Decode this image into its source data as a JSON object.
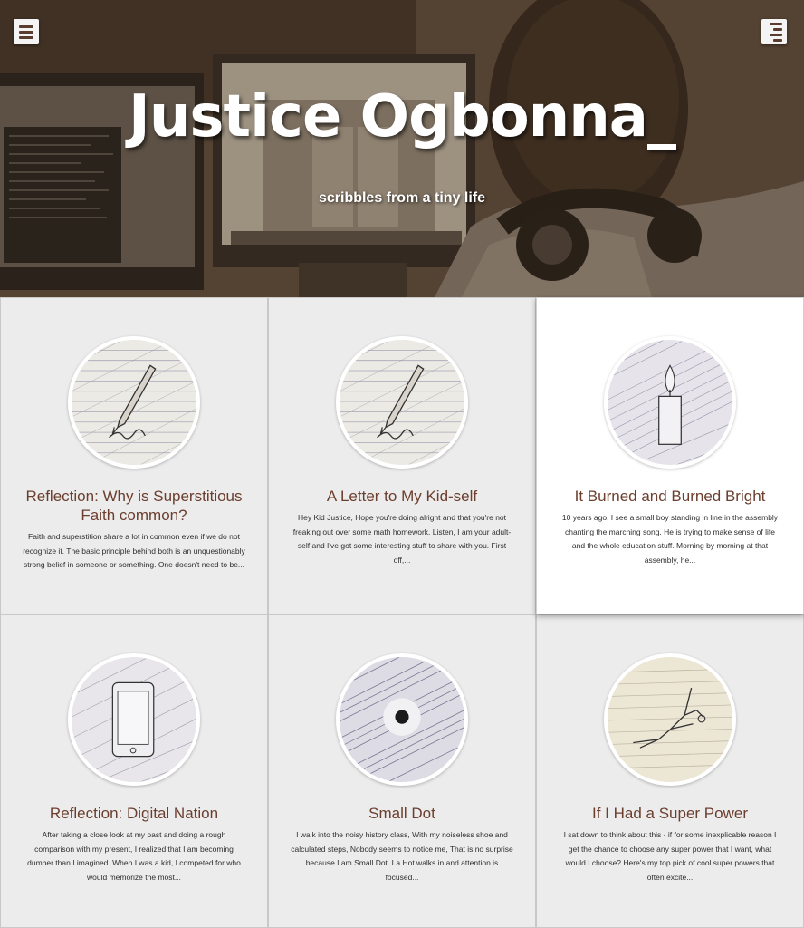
{
  "header": {
    "title": "Justice Ogbonna_",
    "tagline": "scribbles from a tiny life",
    "menu_left_icon": "hamburger-menu-icon",
    "menu_right_icon": "list-menu-icon"
  },
  "colors": {
    "title_text": "#ffffff",
    "card_title": "#6b3e2e",
    "card_bg": "#ececec",
    "card_active_bg": "#ffffff"
  },
  "posts": [
    {
      "title": "Reflection: Why is Superstitious Faith common?",
      "excerpt": "Faith and superstition share a lot in common even if we do not recognize it. The basic principle behind both is an unquestionably strong belief in someone or something. One doesn't need to be...",
      "thumbnail_icon": "fountain-pen-icon"
    },
    {
      "title": "A Letter to My Kid-self",
      "excerpt": "Hey Kid Justice, Hope you're doing alright and that you're not freaking out over some math homework. Listen, I am your adult-self and I've got some interesting stuff to share with you. First off,...",
      "thumbnail_icon": "fountain-pen-icon"
    },
    {
      "title": "It Burned and Burned Bright",
      "excerpt": "10 years ago, I see a small boy standing in line in the assembly chanting the marching song. He is trying to make sense of life and the whole education stuff. Morning by morning at that assembly, he...",
      "thumbnail_icon": "candle-icon"
    },
    {
      "title": "Reflection: Digital Nation",
      "excerpt": "After taking a close look at my past and doing a rough comparison with my present, I realized that I am becoming dumber than I imagined. When I was a kid, I competed for who would memorize the most...",
      "thumbnail_icon": "smartphone-icon"
    },
    {
      "title": "Small Dot",
      "excerpt": "I walk into the noisy history class, With my noiseless shoe and calculated steps, Nobody seems to notice me, That is no surprise because I am Small Dot. La Hot walks in and attention is focused...",
      "thumbnail_icon": "dot-icon"
    },
    {
      "title": "If I Had a Super Power",
      "excerpt": "I sat down to think about this - if for some inexplicable reason I get the chance to choose any super power that I want, what would I choose? Here's my top pick of cool super powers that often excite...",
      "thumbnail_icon": "flying-figure-icon"
    }
  ]
}
